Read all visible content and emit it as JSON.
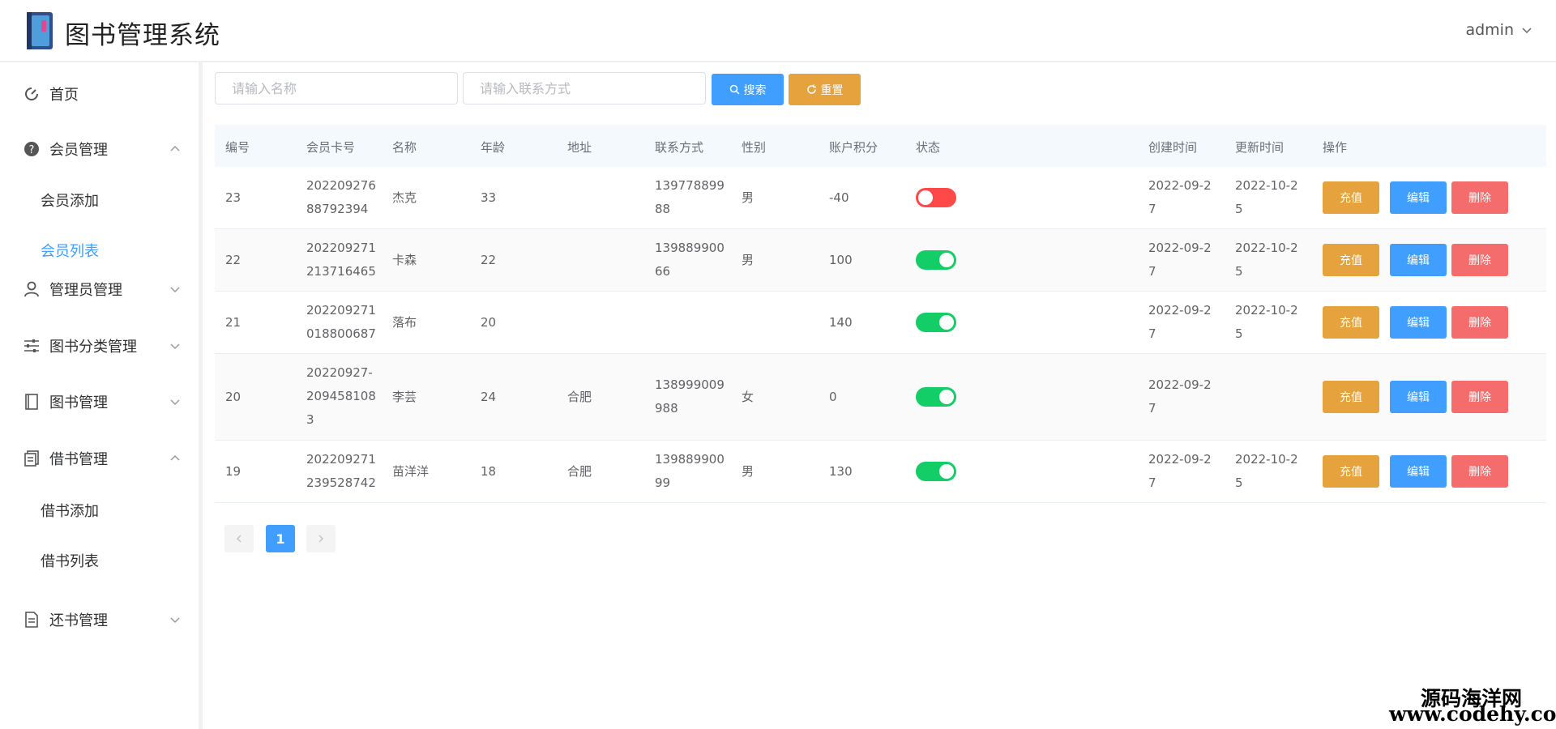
{
  "header": {
    "title": "图书管理系统",
    "user": "admin"
  },
  "sidebar": {
    "items": [
      {
        "label": "首页",
        "icon": "dashboard-icon"
      },
      {
        "label": "会员管理",
        "icon": "help-circle-icon"
      },
      {
        "label": "会员添加"
      },
      {
        "label": "会员列表"
      },
      {
        "label": "管理员管理",
        "icon": "user-icon"
      },
      {
        "label": "图书分类管理",
        "icon": "sliders-icon"
      },
      {
        "label": "图书管理",
        "icon": "book-icon"
      },
      {
        "label": "借书管理",
        "icon": "document-icon"
      },
      {
        "label": "借书添加"
      },
      {
        "label": "借书列表"
      },
      {
        "label": "还书管理",
        "icon": "file-text-icon"
      }
    ],
    "active": "会员列表"
  },
  "search": {
    "name_placeholder": "请输入名称",
    "contact_placeholder": "请输入联系方式",
    "search_label": "搜索",
    "reset_label": "重置"
  },
  "table": {
    "headers": [
      "编号",
      "会员卡号",
      "名称",
      "年龄",
      "地址",
      "联系方式",
      "性别",
      "账户积分",
      "状态",
      "创建时间",
      "更新时间",
      "操作"
    ],
    "rows": [
      {
        "id": "23",
        "card1": "202209276",
        "card2": "88792394",
        "name": "杰克",
        "age": "33",
        "address": "",
        "phone1": "139778899",
        "phone2": "88",
        "gender": "男",
        "points": "-40",
        "status": false,
        "created1": "2022-09-2",
        "created2": "7",
        "updated1": "2022-10-2",
        "updated2": "5"
      },
      {
        "id": "22",
        "card1": "202209271",
        "card2": "213716465",
        "name": "卡森",
        "age": "22",
        "address": "",
        "phone1": "139889900",
        "phone2": "66",
        "gender": "男",
        "points": "100",
        "status": true,
        "created1": "2022-09-2",
        "created2": "7",
        "updated1": "2022-10-2",
        "updated2": "5"
      },
      {
        "id": "21",
        "card1": "202209271",
        "card2": "018800687",
        "name": "落布",
        "age": "20",
        "address": "",
        "phone1": "",
        "phone2": "",
        "gender": "",
        "points": "140",
        "status": true,
        "created1": "2022-09-2",
        "created2": "7",
        "updated1": "2022-10-2",
        "updated2": "5"
      },
      {
        "id": "20",
        "card1": "20220927-",
        "card2": "209458108",
        "card3": "3",
        "name": "李芸",
        "age": "24",
        "address": "合肥",
        "phone1": "138999009",
        "phone2": "988",
        "gender": "女",
        "points": "0",
        "status": true,
        "created1": "2022-09-2",
        "created2": "7",
        "updated1": "",
        "updated2": ""
      },
      {
        "id": "19",
        "card1": "202209271",
        "card2": "239528742",
        "name": "苗洋洋",
        "age": "18",
        "address": "合肥",
        "phone1": "139889900",
        "phone2": "99",
        "gender": "男",
        "points": "130",
        "status": true,
        "created1": "2022-09-2",
        "created2": "7",
        "updated1": "2022-10-2",
        "updated2": "5"
      }
    ],
    "actions": {
      "recharge": "充值",
      "edit": "编辑",
      "delete": "删除"
    }
  },
  "pagination": {
    "current": "1"
  },
  "watermark": {
    "line1": "源码海洋网",
    "line2": "www.codehy.com"
  },
  "colors": {
    "primary": "#409eff",
    "warning": "#e6a23c",
    "danger": "#f56c6c",
    "switch_on": "#13ce66",
    "switch_off": "#ff4949"
  }
}
